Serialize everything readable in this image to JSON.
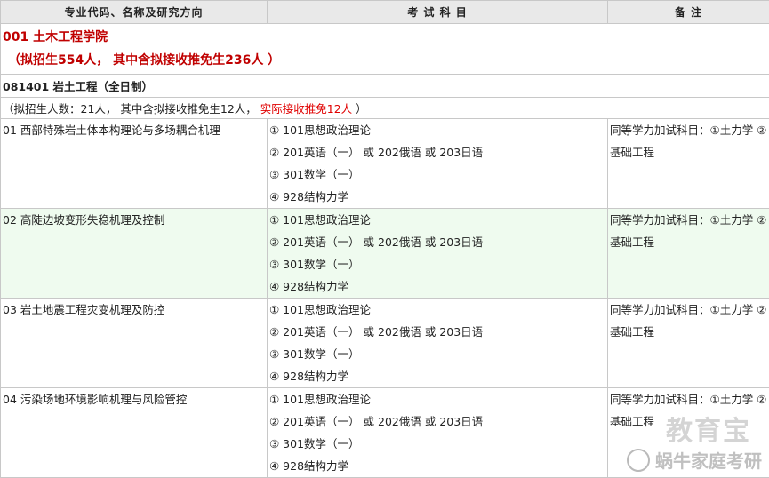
{
  "header": {
    "col1": "专业代码、名称及研究方向",
    "col2": "考 试 科 目",
    "col3": "备 注"
  },
  "school": {
    "name": "001 土木工程学院",
    "quota": "（拟招生554人， 其中含拟接收推免生236人 ）"
  },
  "major": {
    "name": "081401 岩土工程（全日制）",
    "quota_prefix": "（拟招生人数：21人， 其中含拟接收推免生12人，",
    "quota_actual": "实际接收推免12人",
    "quota_suffix": "）"
  },
  "directions": [
    {
      "name": "01 西部特殊岩土体本构理论与多场耦合机理",
      "subjects": [
        "① 101思想政治理论",
        "② 201英语（一） 或 202俄语 或 203日语",
        "③ 301数学（一）",
        "④ 928结构力学"
      ],
      "note": "同等学力加试科目：①土力学 ②基础工程"
    },
    {
      "name": "02 高陡边坡变形失稳机理及控制",
      "subjects": [
        "① 101思想政治理论",
        "② 201英语（一） 或 202俄语 或 203日语",
        "③ 301数学（一）",
        "④ 928结构力学"
      ],
      "note": "同等学力加试科目：①土力学 ②基础工程"
    },
    {
      "name": "03 岩土地震工程灾变机理及防控",
      "subjects": [
        "① 101思想政治理论",
        "② 201英语（一） 或 202俄语 或 203日语",
        "③ 301数学（一）",
        "④ 928结构力学"
      ],
      "note": "同等学力加试科目：①土力学 ②基础工程"
    },
    {
      "name": "04 污染场地环境影响机理与风险管控",
      "subjects": [
        "① 101思想政治理论",
        "② 201英语（一） 或 202俄语 或 203日语",
        "③ 301数学（一）",
        "④ 928结构力学"
      ],
      "note": "同等学力加试科目：①土力学 ②基础工程"
    }
  ],
  "watermark": {
    "brand": "教育宝",
    "account": "蜗牛家庭考研"
  }
}
